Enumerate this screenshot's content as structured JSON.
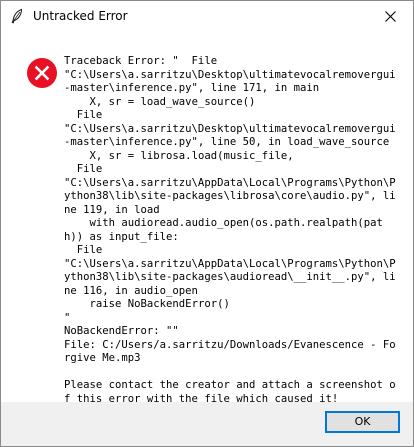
{
  "window": {
    "title": "Untracked Error",
    "icons": {
      "app": "feather-icon",
      "close": "close-icon",
      "error": "error-icon"
    }
  },
  "dialog": {
    "message": "Traceback Error: \"  File\n\"C:\\Users\\a.sarritzu\\Desktop\\ultimatevocalremovergui-master\\inference.py\", line 171, in main\n    X, sr = load_wave_source()\n  File\n\"C:\\Users\\a.sarritzu\\Desktop\\ultimatevocalremovergui-master\\inference.py\", line 50, in load_wave_source\n    X, sr = librosa.load(music_file,\n  File\n\"C:\\Users\\a.sarritzu\\AppData\\Local\\Programs\\Python\\Python38\\lib\\site-packages\\librosa\\core\\audio.py\", line 119, in load\n    with audioread.audio_open(os.path.realpath(path)) as input_file:\n  File\n\"C:\\Users\\a.sarritzu\\AppData\\Local\\Programs\\Python\\Python38\\lib\\site-packages\\audioread\\__init__.py\", line 116, in audio_open\n    raise NoBackendError()\n\"\nNoBackendError: \"\"\nFile: C:/Users/a.sarritzu/Downloads/Evanescence - Forgive Me.mp3\n\nPlease contact the creator and attach a screenshot of this error with the file which caused it!"
  },
  "buttons": {
    "ok_label": "OK"
  },
  "colors": {
    "error_red": "#e81123",
    "focus_border": "#0078d7"
  }
}
